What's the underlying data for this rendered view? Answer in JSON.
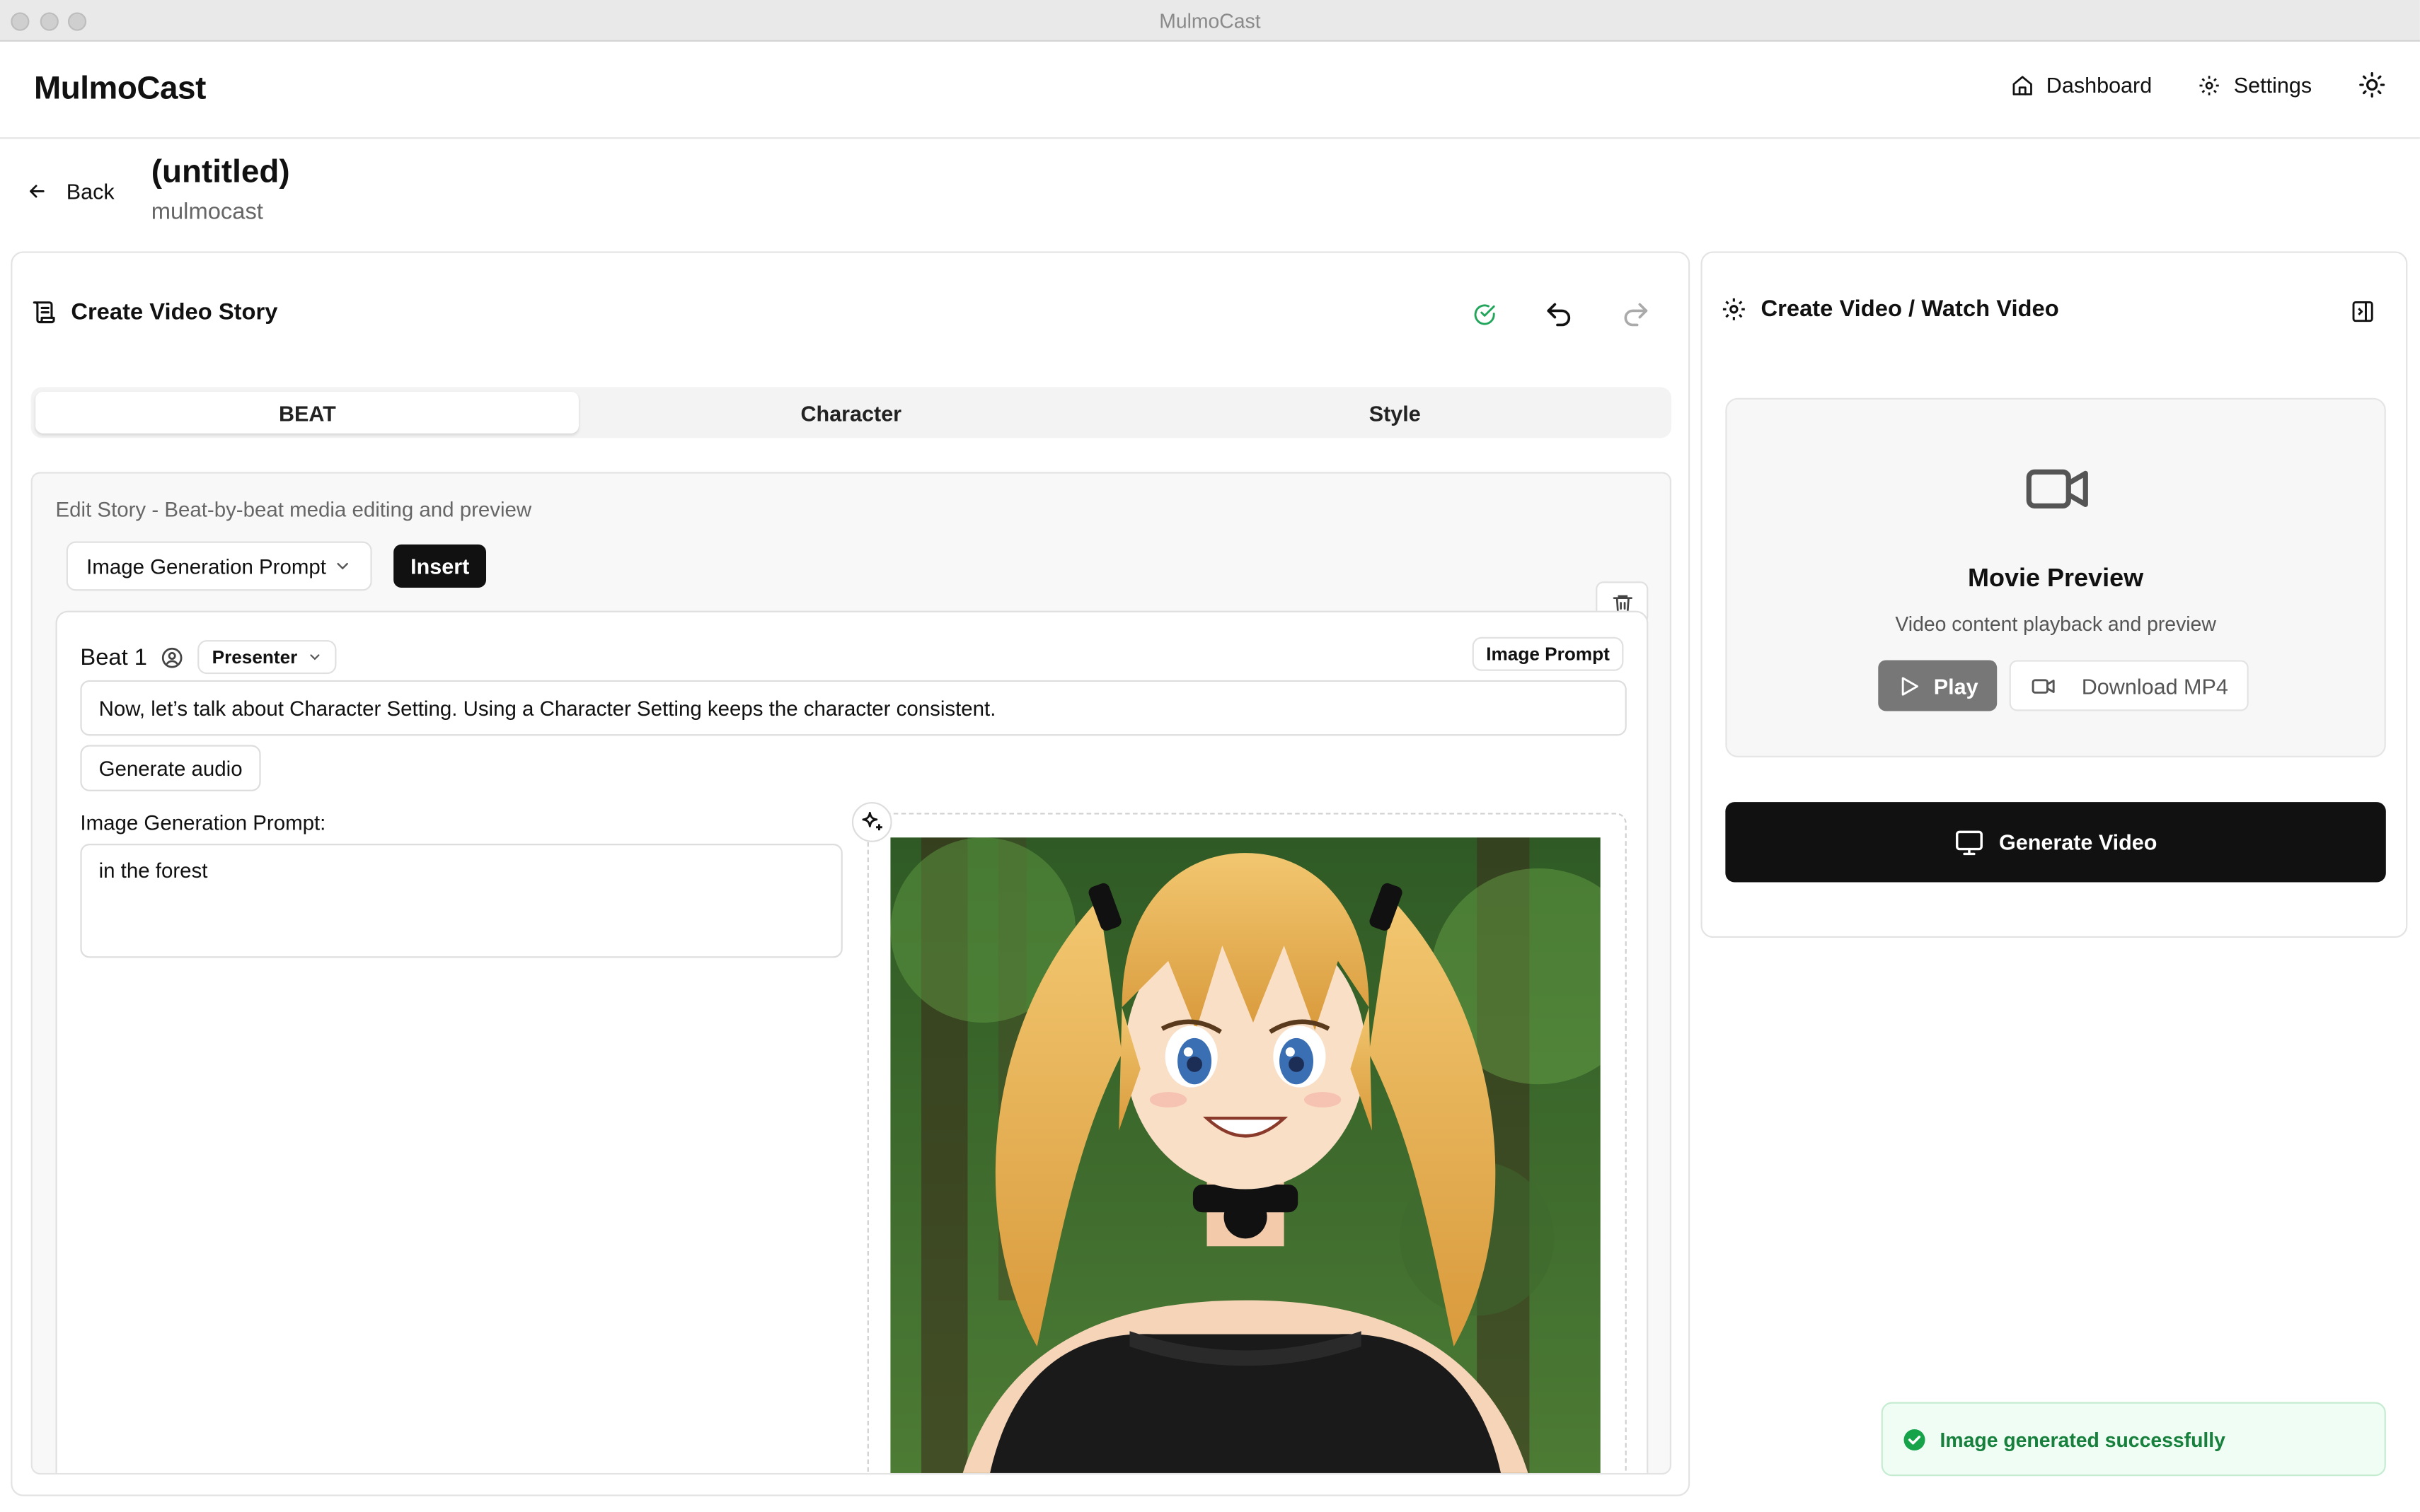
{
  "window": {
    "title": "MulmoCast"
  },
  "header": {
    "brand": "MulmoCast",
    "nav": {
      "dashboard": "Dashboard",
      "settings": "Settings"
    }
  },
  "page": {
    "back_label": "Back",
    "title": "(untitled)",
    "subtitle": "mulmocast"
  },
  "left_panel": {
    "title": "Create Video Story",
    "tabs": [
      {
        "label": "BEAT",
        "active": true
      },
      {
        "label": "Character",
        "active": false
      },
      {
        "label": "Style",
        "active": false
      }
    ],
    "editor": {
      "description": "Edit Story - Beat-by-beat media editing and preview",
      "select_value": "Image Generation Prompt",
      "insert_label": "Insert",
      "beat": {
        "label": "Beat 1",
        "speaker": "Presenter",
        "badge": "Image Prompt",
        "text": "Now, let’s talk about Character Setting. Using a Character Setting keeps the character consistent.",
        "generate_audio_label": "Generate audio",
        "image_prompt_label": "Image Generation Prompt:",
        "image_prompt_value": "in the forest"
      }
    }
  },
  "right_panel": {
    "title": "Create Video / Watch Video",
    "preview": {
      "title": "Movie Preview",
      "subtitle": "Video content playback and preview",
      "play_label": "Play",
      "download_label": "Download MP4"
    },
    "generate_label": "Generate Video"
  },
  "toast": {
    "message": "Image generated successfully",
    "status_color": "#16a34a"
  },
  "icons": [
    "home-icon",
    "gear-icon",
    "sun-icon",
    "arrow-left-icon",
    "scroll-icon",
    "check-circle-icon",
    "undo-icon",
    "redo-icon",
    "chevron-down-icon",
    "trash-icon",
    "user-circle-icon",
    "sparkle-icon",
    "panel-toggle-icon",
    "video-camera-icon",
    "play-icon",
    "monitor-icon"
  ]
}
